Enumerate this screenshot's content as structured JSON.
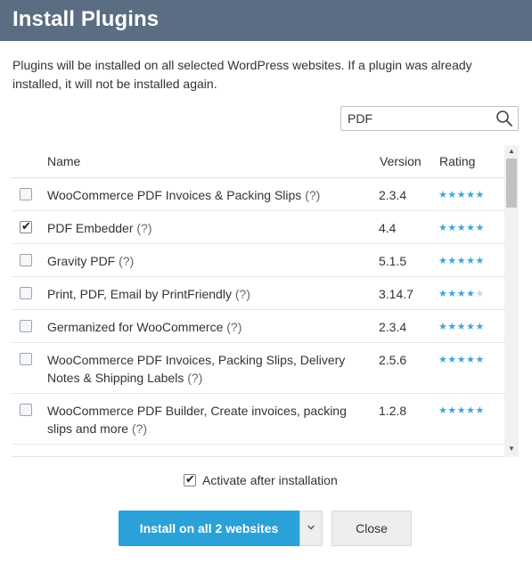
{
  "dialog": {
    "title": "Install Plugins",
    "description": "Plugins will be installed on all selected WordPress websites. If a plugin was already installed, it will not be installed again."
  },
  "search": {
    "value": "PDF",
    "icon": "search-icon"
  },
  "table": {
    "columns": {
      "name": "Name",
      "version": "Version",
      "rating": "Rating"
    },
    "rows": [
      {
        "name": "WooCommerce PDF Invoices & Packing Slips",
        "help": "(?)",
        "version": "2.3.4",
        "stars": 5,
        "checked": false
      },
      {
        "name": "PDF Embedder",
        "help": "(?)",
        "version": "4.4",
        "stars": 5,
        "checked": true
      },
      {
        "name": "Gravity PDF",
        "help": "(?)",
        "version": "5.1.5",
        "stars": 5,
        "checked": false
      },
      {
        "name": "Print, PDF, Email by PrintFriendly",
        "help": "(?)",
        "version": "3.14.7",
        "stars": 4,
        "checked": false
      },
      {
        "name": "Germanized for WooCommerce",
        "help": "(?)",
        "version": "2.3.4",
        "stars": 5,
        "checked": false
      },
      {
        "name": "WooCommerce PDF Invoices, Packing Slips, Delivery Notes & Shipping Labels",
        "help": "(?)",
        "version": "2.5.6",
        "stars": 5,
        "checked": false
      },
      {
        "name": "WooCommerce PDF Builder, Create invoices, packing slips and more",
        "help": "(?)",
        "version": "1.2.8",
        "stars": 5,
        "checked": false
      }
    ]
  },
  "options": {
    "activate_label": "Activate after installation",
    "activate_checked": true
  },
  "buttons": {
    "install_label": "Install on all 2 websites",
    "close_label": "Close"
  },
  "colors": {
    "title_bar": "#5b6d82",
    "primary": "#2aa1d8",
    "star": "#3fa4dd"
  }
}
